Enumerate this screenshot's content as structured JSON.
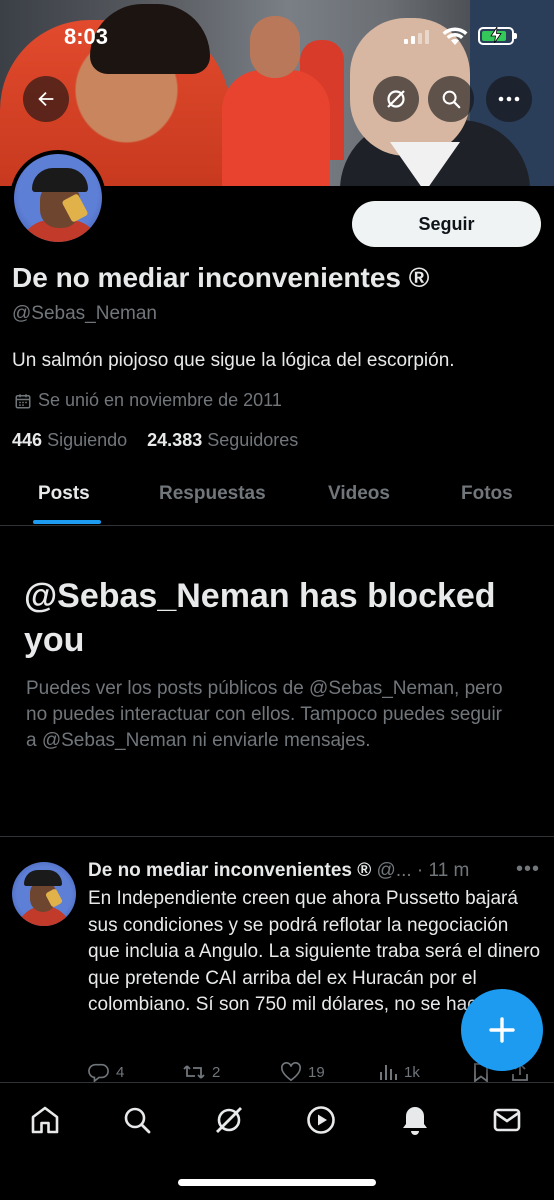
{
  "status_bar": {
    "time": "8:03"
  },
  "profile": {
    "name": "De no mediar inconvenientes ®",
    "handle": "@Sebas_Neman",
    "bio": "Un salmón piojoso que sigue la lógica del escorpión.",
    "joined": "Se unió en noviembre de 2011",
    "following_count": "446",
    "following_label": "Siguiendo",
    "followers_count": "24.383",
    "followers_label": "Seguidores",
    "follow_label": "Seguir"
  },
  "tabs": [
    {
      "label": "Posts",
      "active": true
    },
    {
      "label": "Respuestas"
    },
    {
      "label": "Videos"
    },
    {
      "label": "Fotos"
    }
  ],
  "blocked": {
    "title": "@Sebas_Neman has blocked you",
    "message": "Puedes ver los posts públicos de @Sebas_Neman, pero no puedes interactuar con ellos. Tampoco puedes seguir a @Sebas_Neman ni enviarle mensajes."
  },
  "post": {
    "author": "De no mediar inconvenientes ®",
    "handle_meta": "@... · 11 m",
    "text": "En Independiente creen que ahora Pussetto bajará sus condiciones y se podrá reflotar la negociación que incluia a Angulo. La siguiente traba será el dinero que pretende CAI arriba del ex Huracán por el colombiano. Sí son 750 mil dólares, no se hace.",
    "replies": "4",
    "reposts": "2",
    "likes": "19",
    "views": "1k"
  },
  "colors": {
    "accent": "#1d9bf0",
    "muted": "#71767b",
    "text": "#e7e9ea",
    "background": "#000000"
  },
  "icons": [
    "back-arrow-icon",
    "grok-icon",
    "search-icon",
    "more-icon",
    "calendar-icon",
    "reply-icon",
    "repost-icon",
    "like-icon",
    "views-icon",
    "bookmark-icon",
    "share-icon",
    "compose-plus-icon",
    "home-icon",
    "explore-icon",
    "grok-nav-icon",
    "video-icon",
    "notifications-icon",
    "messages-icon"
  ]
}
